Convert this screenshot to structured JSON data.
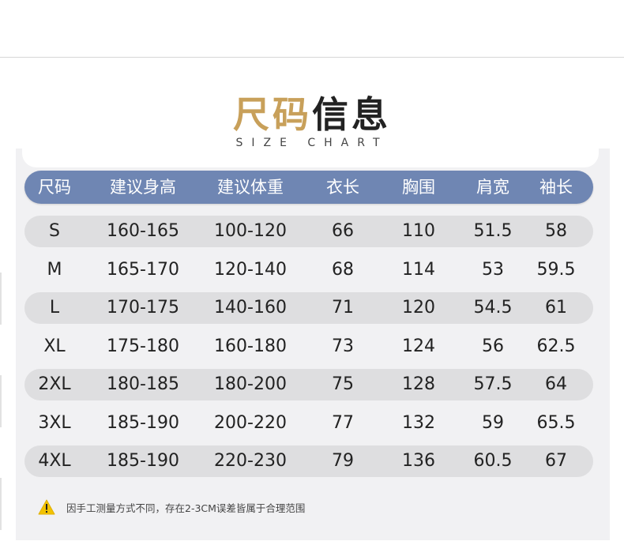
{
  "heading": {
    "title_part1": "尺码",
    "title_part2": "信息",
    "subtitle": "SIZE CHART"
  },
  "colors": {
    "title_accent": "#c8a05a",
    "header_bar": "#6f86b3",
    "row_shade": "#dedee0",
    "warning": "#f2c200"
  },
  "table": {
    "headers": [
      "尺码",
      "建议身高",
      "建议体重",
      "衣长",
      "胸围",
      "肩宽",
      "袖长"
    ],
    "rows": [
      [
        "S",
        "160-165",
        "100-120",
        "66",
        "110",
        "51.5",
        "58"
      ],
      [
        "M",
        "165-170",
        "120-140",
        "68",
        "114",
        "53",
        "59.5"
      ],
      [
        "L",
        "170-175",
        "140-160",
        "71",
        "120",
        "54.5",
        "61"
      ],
      [
        "XL",
        "175-180",
        "160-180",
        "73",
        "124",
        "56",
        "62.5"
      ],
      [
        "2XL",
        "180-185",
        "180-200",
        "75",
        "128",
        "57.5",
        "64"
      ],
      [
        "3XL",
        "185-190",
        "200-220",
        "77",
        "132",
        "59",
        "65.5"
      ],
      [
        "4XL",
        "185-190",
        "220-230",
        "79",
        "136",
        "60.5",
        "67"
      ]
    ]
  },
  "note": {
    "icon": "warning-icon",
    "text": "因手工测量方式不同，存在2-3CM误差皆属于合理范围"
  }
}
